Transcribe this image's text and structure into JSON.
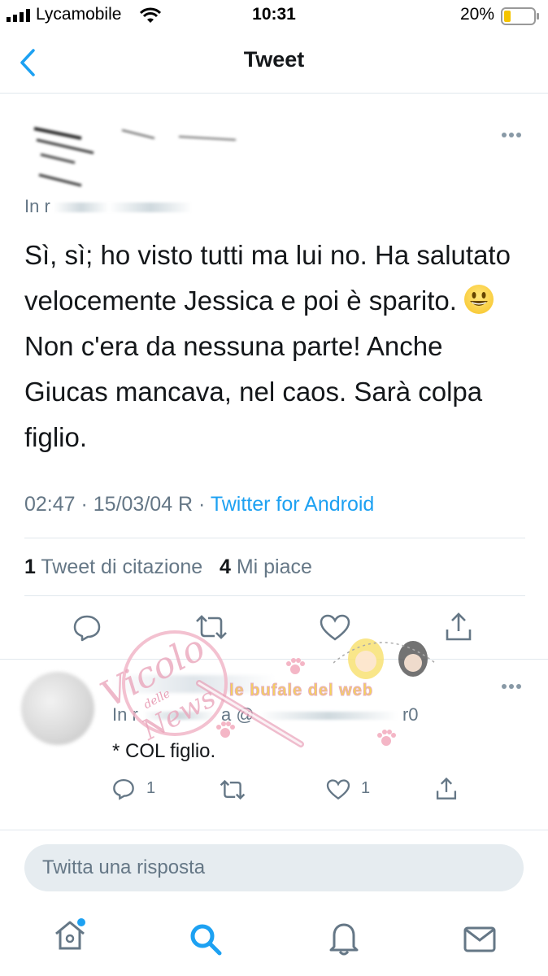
{
  "status_bar": {
    "carrier": "Lycamobile",
    "time": "10:31",
    "battery_pct": "20%",
    "battery_color": "#f5c400"
  },
  "nav": {
    "back_icon": "chevron-left-icon",
    "title": "Tweet"
  },
  "tweet": {
    "reply_prefix": "In r",
    "text": "Sì, sì; ho visto tutti ma lui no. Ha salutato velocemente Jessica e poi è sparito.",
    "text_after_emoji": "Non c'era da nessuna parte! Anche Giucas mancava, nel caos. Sarà colpa figlio.",
    "time": "02:47 · 15/03/04 R · ",
    "source": "Twitter for Android",
    "retweets_count": "1",
    "retweets_label": "Tweet di citazione",
    "likes_count": "4",
    "likes_label": "Mi piace"
  },
  "reply": {
    "handle_prefix": "In r",
    "handle_mid": "a @",
    "handle_suffix": "r0",
    "text": "* COL figlio.",
    "reply_count": "1",
    "like_count": "1"
  },
  "compose": {
    "placeholder": "Twitta una risposta"
  },
  "tab_bar": {
    "items": [
      "home-icon",
      "search-icon",
      "notifications-icon",
      "messages-icon"
    ]
  },
  "watermark": {
    "text1": "Vicolo",
    "text2": "delle",
    "text3": "News",
    "web_text": "le bufale del web"
  },
  "colors": {
    "accent": "#1da1f2",
    "muted": "#657786",
    "text": "#14171a",
    "divider": "#e1e8ed"
  }
}
